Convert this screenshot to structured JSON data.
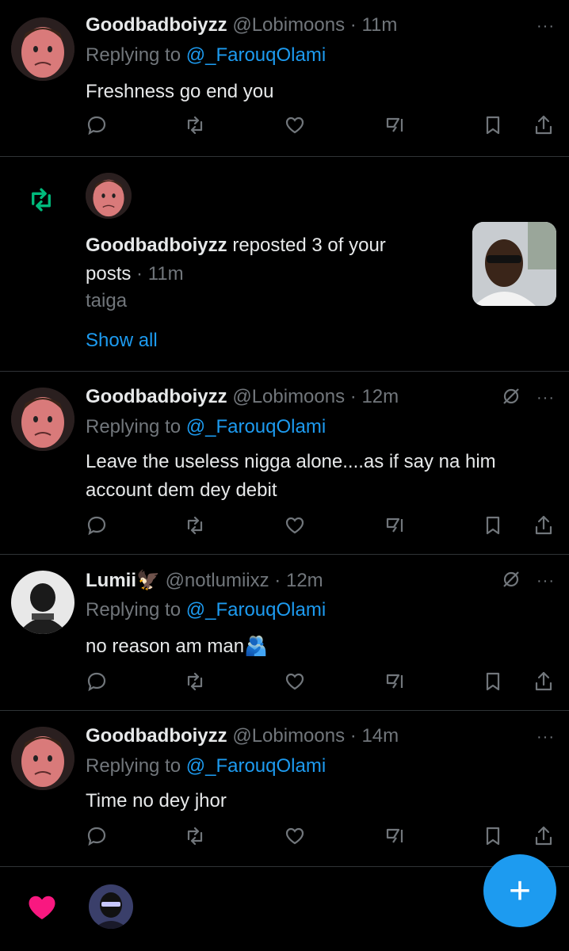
{
  "tweets": [
    {
      "name": "Goodbadboiyzz",
      "handle": "@Lobimoons",
      "sep": "·",
      "time": "11m",
      "replying_prefix": "Replying to ",
      "replying_to": "@_FarouqOlami",
      "text": "Freshness go end you",
      "more": "···"
    },
    {
      "name": "Goodbadboiyzz",
      "handle": "@Lobimoons",
      "sep": "·",
      "time": "12m",
      "replying_prefix": "Replying to ",
      "replying_to": "@_FarouqOlami",
      "text": "Leave the useless nigga alone....as if say na him account dem dey debit",
      "more": "···"
    },
    {
      "name": "Lumii🦅",
      "handle": "@notlumiixz",
      "sep": "·",
      "time": "12m",
      "replying_prefix": "Replying to ",
      "replying_to": "@_FarouqOlami",
      "text": "no reason am man🫂",
      "more": "···"
    },
    {
      "name": "Goodbadboiyzz",
      "handle": "@Lobimoons",
      "sep": "·",
      "time": "14m",
      "replying_prefix": "Replying to ",
      "replying_to": "@_FarouqOlami",
      "text": "Time no dey jhor",
      "more": "···"
    }
  ],
  "repost_notification": {
    "name": "Goodbadboiyzz",
    "text_suffix": " reposted 3 of your",
    "text_line2": "posts",
    "sep": "·",
    "time": "11m",
    "quote": "taiga",
    "show_all": "Show all"
  },
  "actions": [
    "reply-icon",
    "repost-icon",
    "like-icon",
    "grok-icon",
    "bookmark-icon",
    "share-icon"
  ],
  "fab_label": "+",
  "colors": {
    "background": "#000000",
    "text": "#e7e9ea",
    "muted": "#71767b",
    "accent": "#1d9bf0",
    "repost_green": "#00ba7c",
    "like_pink": "#f91880",
    "divider": "#2f3336"
  }
}
